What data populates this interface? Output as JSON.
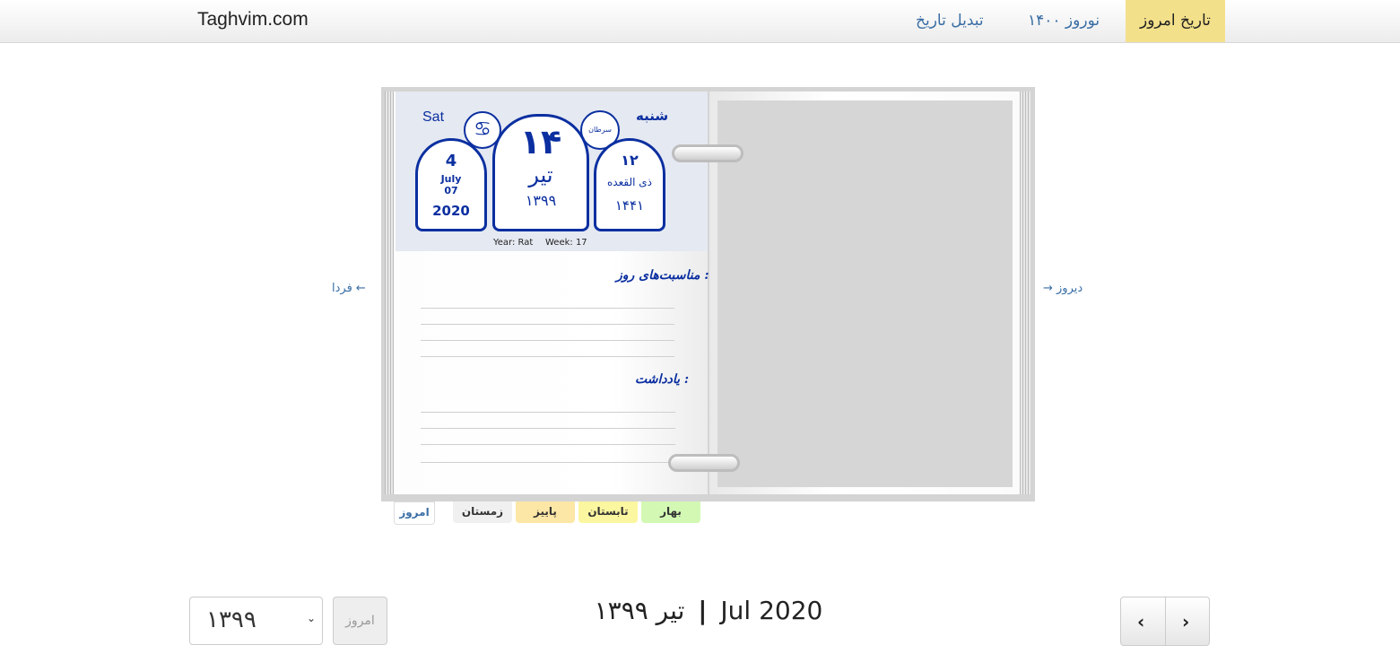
{
  "navbar": {
    "brand": "Taghvim.com",
    "items": [
      {
        "label": "تاریخ امروز"
      },
      {
        "label": "نوروز ۱۴۰۰"
      },
      {
        "label": "تبدیل تاریخ"
      }
    ]
  },
  "calendar": {
    "weekday_en": "Sat",
    "weekday_fa": "شنبه",
    "gregorian": {
      "day": "4",
      "month": "July",
      "month_num": "07",
      "year": "2020"
    },
    "persian": {
      "day": "۱۴",
      "month": "تیر",
      "year": "۱۳۹۹"
    },
    "hijri": {
      "day": "۱۲",
      "month": "ذی القعده",
      "year": "۱۴۴۱"
    },
    "zodiac_label": "سرطان",
    "zodiac_symbol": "♋",
    "year_animal": "Year: Rat",
    "week": "Week: 17",
    "occasions_label": "مناسبت‌های روز :",
    "notes_label": "یادداشت :"
  },
  "season_tabs": [
    "امروز",
    "زمستان",
    "پاییز",
    "تابستان",
    "بهار"
  ],
  "colors": {
    "today_tab": "#ffffff",
    "winter": "#f0f0f0",
    "autumn": "#fde7a6",
    "summer": "#fbf6a0",
    "spring": "#d3f8b4",
    "accent_blue": "#0b2fa0",
    "nav_active": "#f3e08a"
  },
  "side_nav": {
    "tomorrow": "فردا ←",
    "yesterday": "→ دیروز"
  },
  "footer": {
    "year_select_value": "۱۳۹۹",
    "today_button": "امروز",
    "month_title_en": "Jul 2020",
    "separator": "|",
    "month_title_fa": "تیر ۱۳۹۹",
    "prev_icon": "chevron-left-icon",
    "next_icon": "chevron-right-icon"
  }
}
